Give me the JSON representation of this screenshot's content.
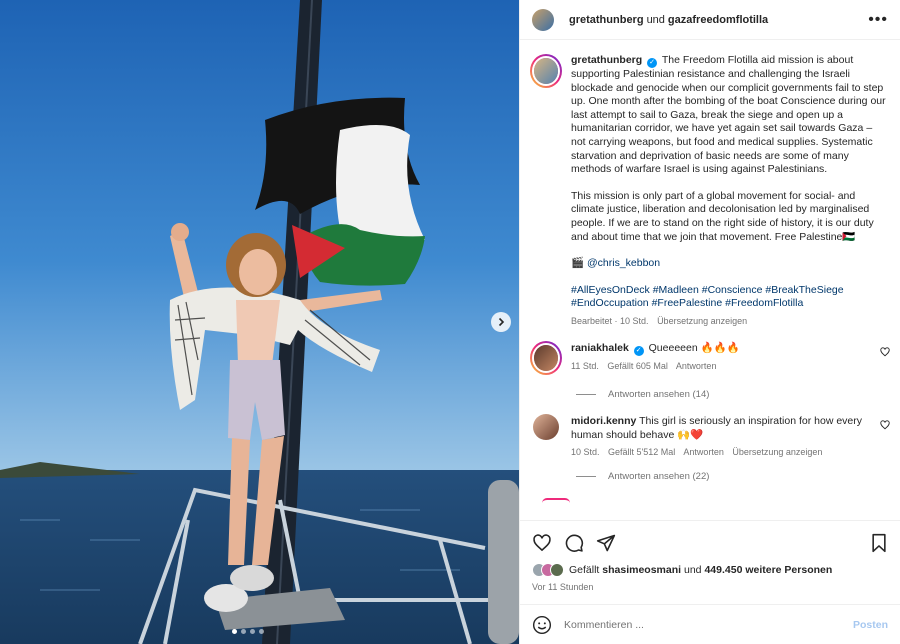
{
  "header": {
    "author": "gretathunberg",
    "connector": "und",
    "collaborator": "gazafreedomflotilla",
    "more_label": "•••"
  },
  "caption": {
    "author": "gretathunberg",
    "paragraph1": "The Freedom Flotilla aid mission is about supporting Palestinian resistance and challenging the Israeli blockade and genocide when our complicit governments fail to step up. One month after the bombing of the boat Conscience during our last attempt to sail to Gaza, break the siege and open up a humanitarian corridor, we have yet again set sail towards Gaza – not carrying weapons, but food and medical supplies. Systematic starvation and deprivation of basic needs are some of many methods of warfare Israel is using against Palestinians.",
    "paragraph2": "This mission is only part of a global movement for social- and climate justice, liberation and decolonisation led by marginalised people. If we are to stand on the right side of history, it is our duty and about time that we join that movement. Free Palestine🇵🇸",
    "credit_icon": "🎬",
    "credit": "@chris_kebbon",
    "hashtags": [
      "#AllEyesOnDeck",
      "#Madleen",
      "#Conscience",
      "#BreakTheSiege",
      "#EndOccupation",
      "#FreePalestine",
      "#FreedomFlotilla"
    ],
    "edited": "Bearbeitet · 10 Std.",
    "translate": "Übersetzung anzeigen"
  },
  "comments": [
    {
      "user": "raniakhalek",
      "verified": true,
      "text": "Queeeeen 🔥🔥🔥",
      "time": "11 Std.",
      "likes": "Gefällt 605 Mal",
      "reply": "Antworten",
      "translate": "",
      "view_replies": "Antworten ansehen (14)"
    },
    {
      "user": "midori.kenny",
      "verified": false,
      "text": "This girl is seriously an inspiration for how every human should behave 🙌❤️",
      "time": "10 Std.",
      "likes": "Gefällt 5'512 Mal",
      "reply": "Antworten",
      "translate": "Übersetzung anzeigen",
      "view_replies": "Antworten ansehen (22)"
    }
  ],
  "likes": {
    "prefix": "Gefällt",
    "first_user": "shasimeosmani",
    "connector": "und",
    "others": "449.450 weitere Personen"
  },
  "posted": "Vor 11 Stunden",
  "composer": {
    "placeholder": "Kommentieren ...",
    "post_label": "Posten"
  },
  "carousel": {
    "slides": 4,
    "active": 0
  },
  "colors": {
    "link": "#00376b",
    "verified": "#0095f6",
    "muted": "#737373",
    "post_disabled": "#a7c8f0"
  }
}
